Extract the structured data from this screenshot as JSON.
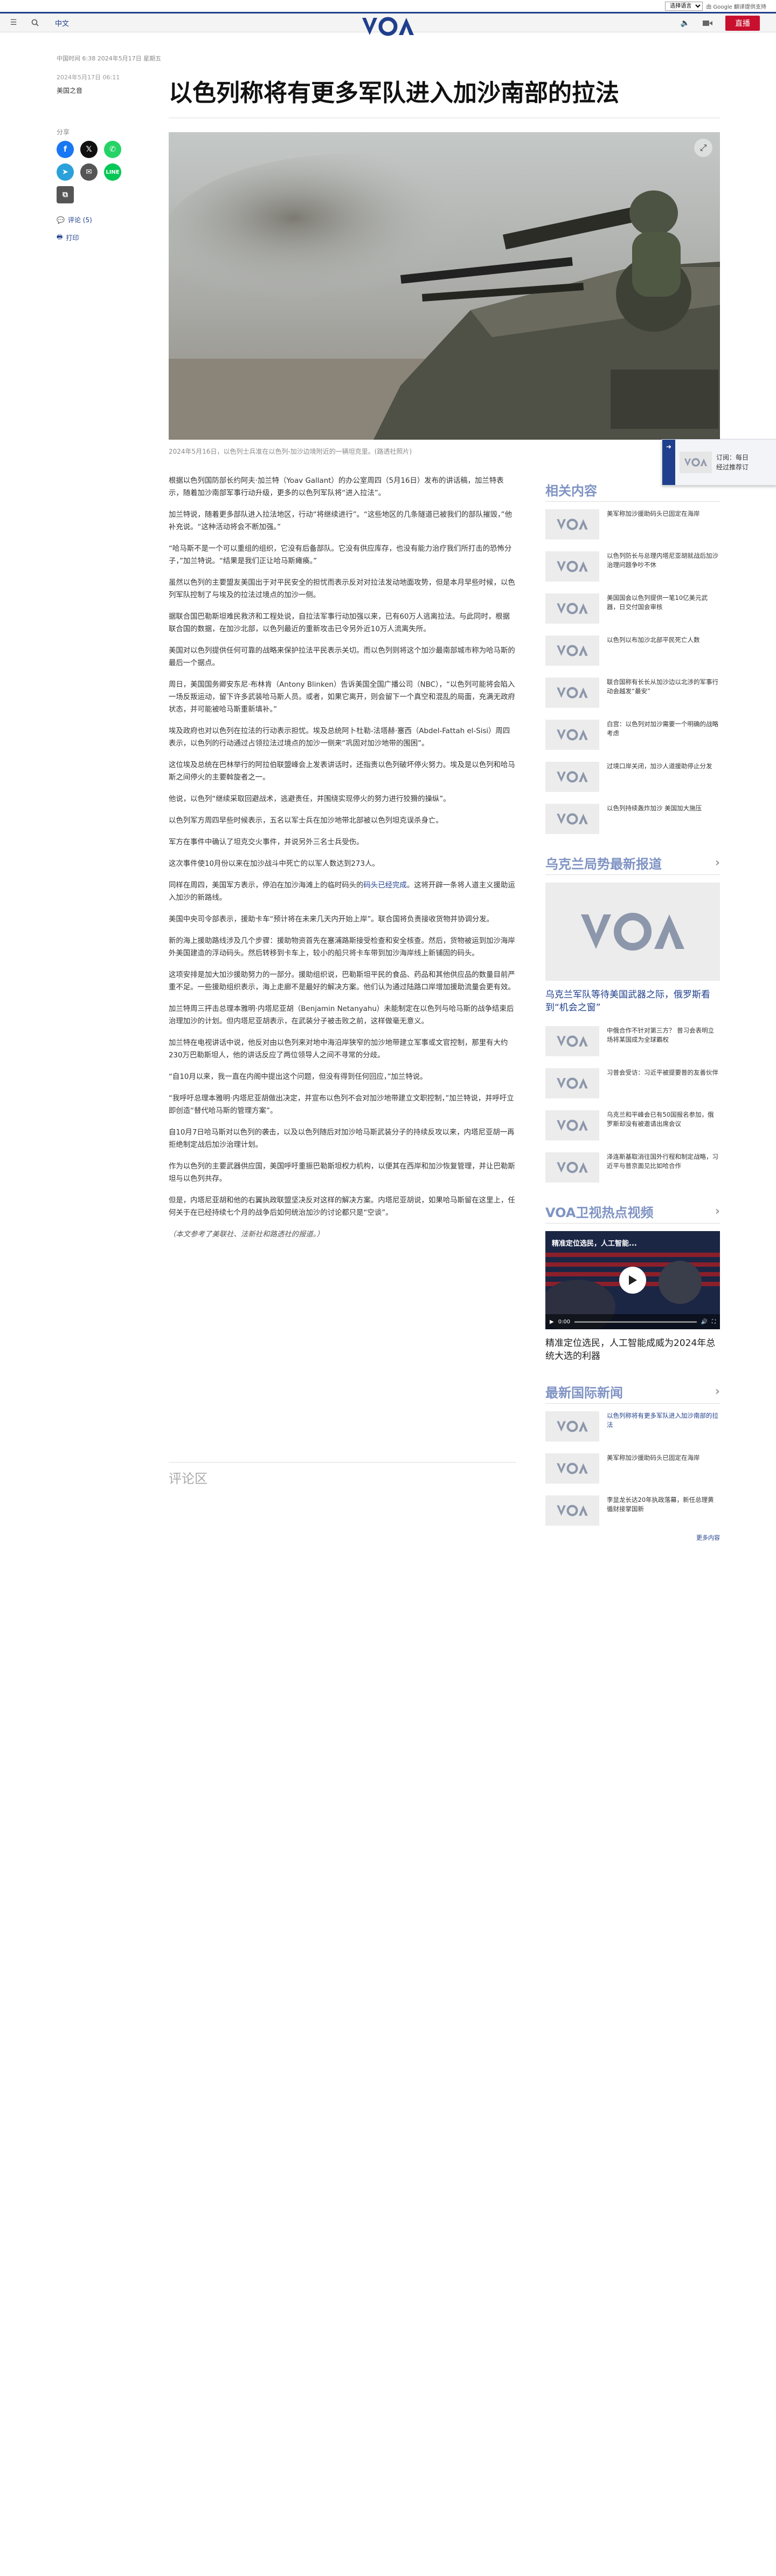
{
  "translate": {
    "select_label": "选择语言",
    "powered": "由 Google 翻译提供支持"
  },
  "header": {
    "language": "中文",
    "live_label": "直播"
  },
  "meta_line": "中国时间 6:38 2024年5月17日 星期五",
  "article": {
    "date": "2024年5月17日 06:11",
    "author": "美国之音",
    "title": "以色列称将有更多军队进入加沙南部的拉法",
    "image_caption": "2024年5月16日，以色列士兵准在以色列-加沙边境附近的一辆坦克里。(路透社照片)",
    "paragraphs": [
      "根据以色列国防部长约阿夫·加兰特（Yoav Gallant）的办公室周四（5月16日）发布的讲话稿，加兰特表示，随着加沙南部军事行动升级，更多的以色列军队将“进入拉法”。",
      "加兰特说，随着更多部队进入拉法地区，行动“将继续进行”。“这些地区的几条隧道已被我们的部队摧毁，”他补充说。“这种活动将会不断加强。”",
      "“哈马斯不是一个可以重组的组织，它没有后备部队。它没有供应库存，也没有能力治疗我们所打击的恐怖分子，”加兰特说。“结果是我们正让哈马斯瘫痪。”",
      "虽然以色列的主要盟友美国出于对平民安全的担忧而表示反对对拉法发动地面攻势，但是本月早些时候，以色列军队控制了与埃及的拉法过境点的加沙一侧。",
      "据联合国巴勒斯坦难民救济和工程处说，自拉法军事行动加强以来，已有60万人逃离拉法。与此同时，根据联合国的数据，在加沙北部，以色列最近的重新攻击已令另外近10万人流离失所。",
      "美国对以色列提供任何可靠的战略来保护拉法平民表示关切。而以色列则将这个加沙最南部城市称为哈马斯的最后一个据点。",
      "周日，美国国务卿安东尼·布林肯（Antony Blinken）告诉美国全国广播公司（NBC），“以色列可能将会陷入一场反叛运动，留下许多武装哈马斯人员。或者，如果它离开，则会留下一个真空和混乱的局面，充满无政府状态，并可能被哈马斯重新填补。”",
      "埃及政府也对以色列在拉法的行动表示担忧。埃及总统阿卜杜勒-法塔赫·塞西（Abdel-Fattah el-Sisi）周四表示，以色列的行动通过占领拉法过境点的加沙一侧来“巩固对加沙地带的围困”。",
      "这位埃及总统在巴林举行的阿拉伯联盟峰会上发表讲话时，还指责以色列破坏停火努力。埃及是以色列和哈马斯之间停火的主要斡旋者之一。",
      "他说，以色列“继续采取回避战术，逃避责任，并围绕实现停火的努力进行狡猾的操纵”。",
      "以色列军方周四早些时候表示，五名以军士兵在加沙地带北部被以色列坦克误杀身亡。",
      "军方在事件中确认了坦克交火事件，并说另外三名士兵受伤。",
      "这次事件使10月份以来在加沙战斗中死亡的以军人数达到273人。",
      "同样在周四，美国军方表示，停泊在加沙海滩上的临时码头的",
      "美国中央司令部表示，援助卡车“预计将在未来几天内开始上岸”。联合国将负责接收货物并协调分发。",
      "新的海上援助路线涉及几个步骤：援助物资首先在塞浦路斯接受检查和安全核查。然后，货物被运到加沙海岸外美国建造的浮动码头。然后转移到卡车上，较小的船只将卡车带到加沙海岸线上新铺固的码头。",
      "这项安排是加大加沙援助努力的一部分。援助组织说，巴勒斯坦平民的食品、药品和其他供应品的数量目前严重不足。一些援助组织表示，海上走廊不是最好的解决方案。他们认为通过陆路口岸增加援助流量会更有效。",
      "加兰特周三抨击总理本雅明·内塔尼亚胡（Benjamin Netanyahu）未能制定在以色列与哈马斯的战争结束后治理加沙的计划。但内塔尼亚胡表示，在武装分子被击败之前，这样做毫无意义。",
      "加兰特在电视讲话中说，他反对由以色列来对地中海沿岸狭窄的加沙地带建立军事或文官控制，那里有大约230万巴勒斯坦人，他的讲话反应了两位领导人之间不寻常的分歧。",
      "“自10月以来，我一直在内阁中提出这个问题，但没有得到任何回应，”加兰特说。",
      "“我呼吁总理本雅明·内塔尼亚胡做出决定，并宣布以色列不会对加沙地带建立文职控制，”加兰特说，并呼吁立即创造“替代哈马斯的管理方案”。",
      "自10月7日哈马斯对以色列的袭击，以及以色列随后对加沙哈马斯武装分子的持续反攻以来，内塔尼亚胡一再拒绝制定战后加沙治理计划。",
      "作为以色列的主要武器供应国，美国呼吁重振巴勒斯坦权力机构，以便其在西岸和加沙恢复管理，并让巴勒斯坦与以色列共存。",
      "但是，内塔尼亚胡和他的右翼执政联盟坚决反对这样的解决方案。内塔尼亚胡说，如果哈马斯留在这里上，任何关于在已经持续七个月的战争后如何统治加沙的讨论都只是“空谈”。"
    ],
    "link_text": "码头已经完成",
    "link_tail": "。这将开辟一条将人道主义援助运入加沙的新路线。",
    "note": "（本文参考了美联社、法新社和路透社的报道。）",
    "share_label": "分享",
    "comments_label": "评论 (5)",
    "print_label": "打印",
    "comments_heading": "评论区"
  },
  "sidebar": {
    "related_heading": "相关内容",
    "related": [
      "美军称加沙援助码头已固定在海岸",
      "以色列防长与总理内塔尼亚胡就战后加沙治理问题争吵不休",
      "美国国会以色列提供一笔10亿美元武器，日交付国会审核",
      "以色列以布加沙北部平民死亡人数",
      "联合国称有长长从加沙边以北涉的军事行动会越发“最安”",
      "白宫：以色列对加沙需要一个明确的战略考虑",
      "过境口岸关闭，加沙人道援助停止分发",
      "以色列持续轰炸加沙 美国加大施压"
    ],
    "ukraine_heading": "乌克兰局势最新报道",
    "ukraine_feature": "乌克兰军队等待美国武器之际，俄罗斯看到“机会之窗”",
    "ukraine": [
      "中俄合作不针对第三方？ 普习会表明立场将某国成为全球霸权",
      "习普会受访：习近平被提要普的友善伙伴",
      "乌克兰和平峰会已有50国报名参加，俄罗斯却没有被邀请出席会议",
      "泽连斯基取消往国外行程和制定战略，习近平与普京面见比如哈合作"
    ],
    "video_heading": "VOA卫视热点视频",
    "video_overlay_title": "精准定位选民，人工智能...",
    "video_time": "0:00",
    "video_title": "精准定位选民，人工智能成威为2024年总统大选的利器",
    "intl_heading": "最新国际新闻",
    "intl": [
      "以色列称将有更多军队进入加沙南部的拉法",
      "美军称加沙援助码头已固定在海岸",
      "李显龙长达20年执政落幕，新任总理黄循财接掌国新"
    ],
    "more_label": "更多内容"
  },
  "toast": {
    "text_line1": "订阅：每日",
    "text_line2": "经过推荐订"
  },
  "icons": {
    "menu": "menu-icon",
    "search": "search-icon",
    "audio": "audio-icon",
    "video": "video-icon",
    "facebook": "facebook-icon",
    "x": "x-icon",
    "whatsapp": "whatsapp-icon",
    "telegram": "telegram-icon",
    "email": "email-icon",
    "line": "line-icon",
    "copy": "copy-icon",
    "comment": "comment-icon",
    "print": "print-icon",
    "expand": "expand-icon",
    "play": "play-icon"
  },
  "colors": {
    "brand": "#1f3f8c",
    "live": "#c8102e",
    "link": "#1f3f8c"
  }
}
